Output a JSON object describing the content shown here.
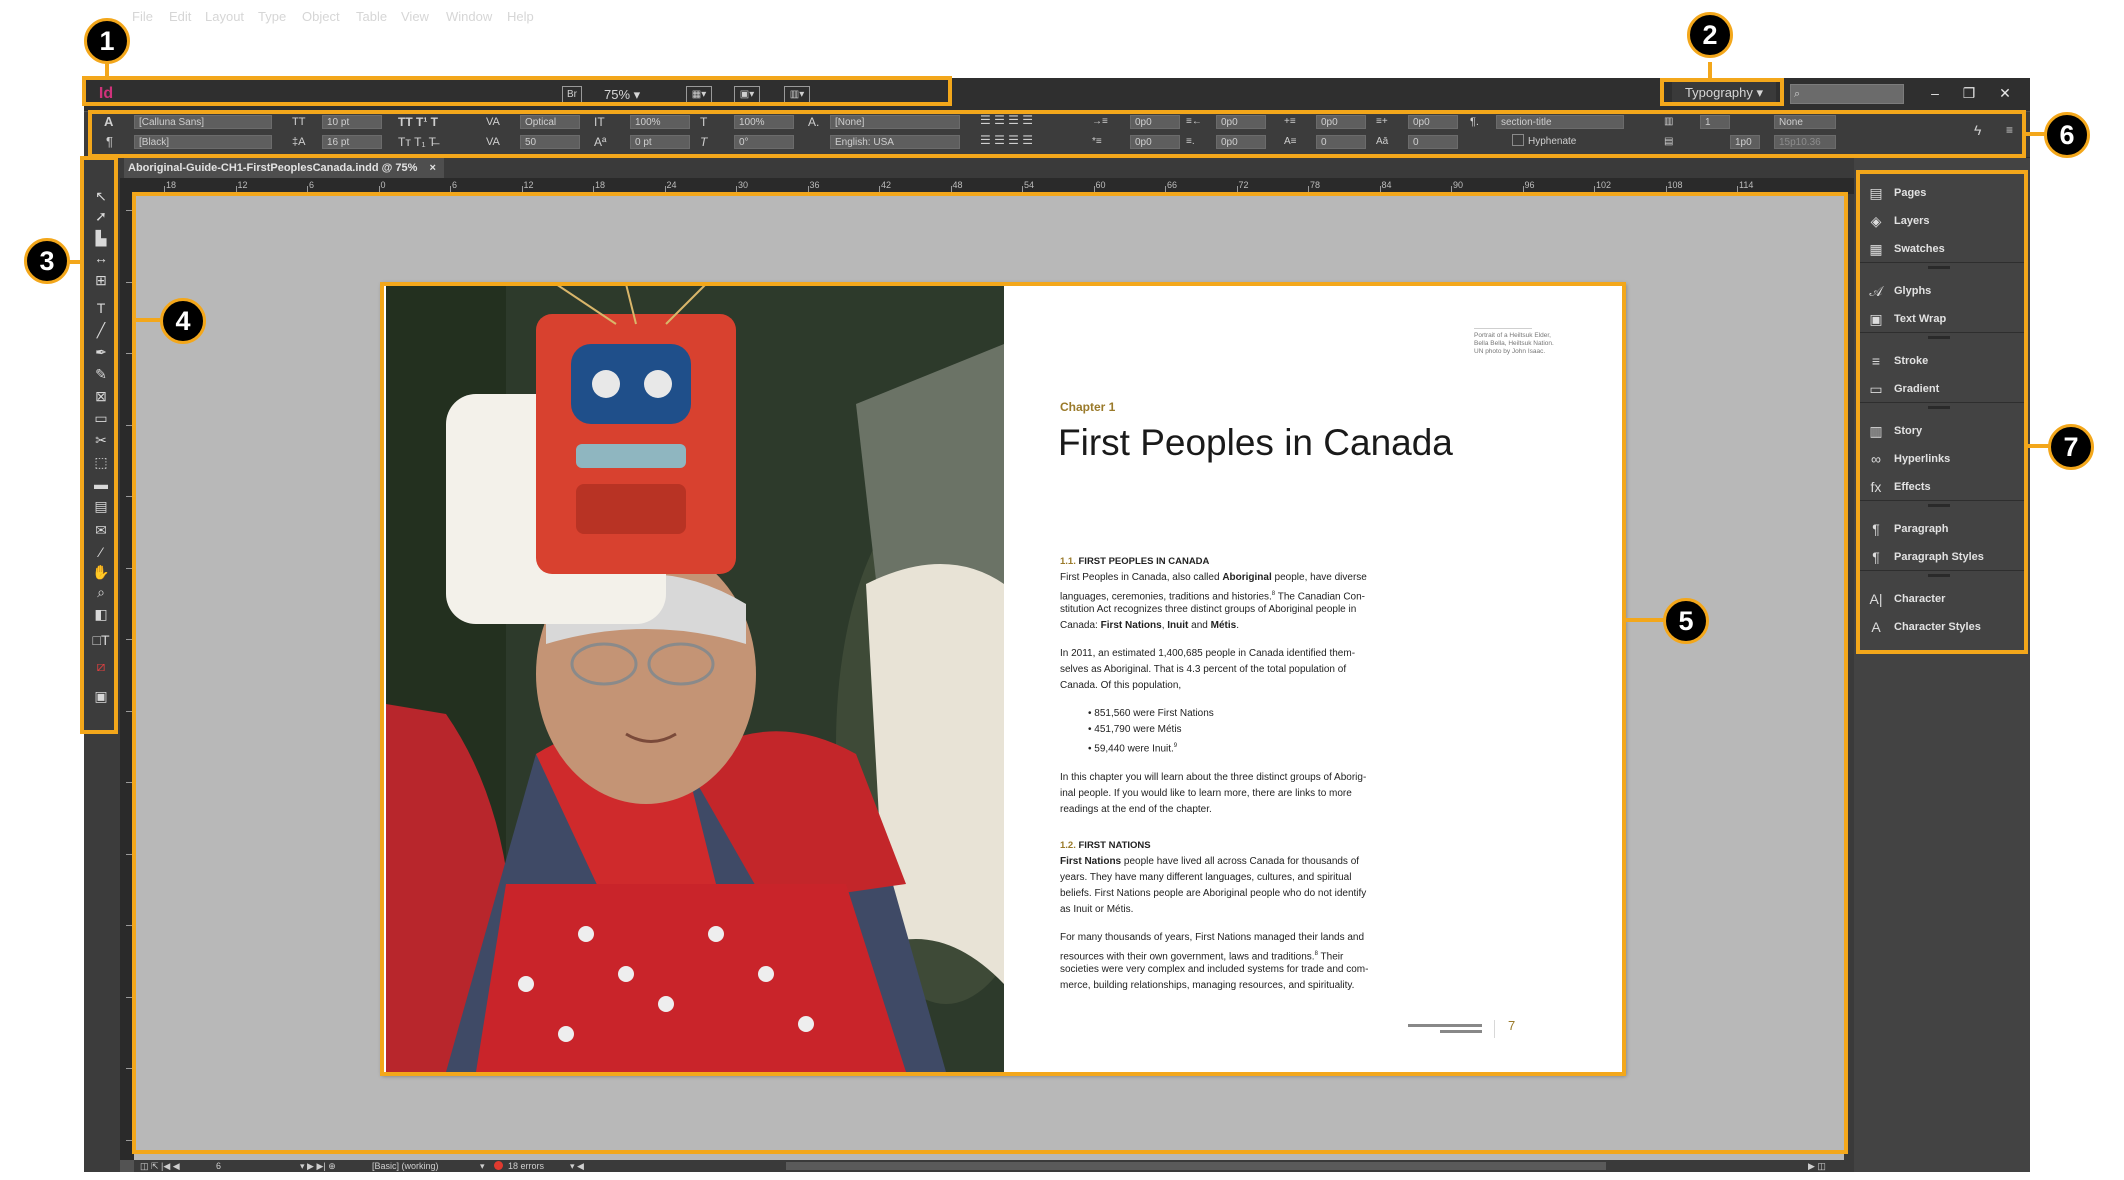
{
  "menubar": {
    "app_logo": "Id",
    "items": [
      "File",
      "Edit",
      "Layout",
      "Type",
      "Object",
      "Table",
      "View",
      "Window",
      "Help"
    ],
    "bridge_label": "Br",
    "zoom": "75%",
    "workspace": "Typography",
    "window_buttons": [
      "–",
      "❐",
      "✕"
    ]
  },
  "control": {
    "font_family": "[Calluna Sans]",
    "font_style": "[Black]",
    "font_size": "10 pt",
    "leading": "16 pt",
    "kerning": "Optical",
    "tracking": "50",
    "vscale": "100%",
    "hscale": "100%",
    "baseline": "0 pt",
    "skew": "0°",
    "char_style": "[None]",
    "language": "English: USA",
    "indent_left": "0p0",
    "indent_right": "0p0",
    "indent_first": "0p0",
    "indent_last": "0p0",
    "space_before": "0p0",
    "space_after": "0p0",
    "dropcap_lines": "0",
    "dropcap_chars": "0",
    "para_style": "section-title",
    "hyphenate": "Hyphenate",
    "columns": "1",
    "gutter": "1p0",
    "align_none": "None",
    "x_value": "15p10.36"
  },
  "document_tab": "Aboriginal-Guide-CH1-FirstPeoplesCanada.indd @ 75%",
  "ruler": [
    "18",
    "12",
    "6",
    "0",
    "6",
    "12",
    "18",
    "24",
    "30",
    "36",
    "42",
    "48",
    "54",
    "60",
    "66",
    "72",
    "78",
    "84",
    "90",
    "96",
    "102",
    "108",
    "114"
  ],
  "status": {
    "page": "6",
    "preflight_profile": "[Basic] (working)",
    "errors": "18 errors"
  },
  "page": {
    "caption": [
      "Portrait of a Heiltsuk Elder,",
      "Bella Bella, Heiltsuk Nation.",
      "UN photo by John Isaac."
    ],
    "chapter": "Chapter 1",
    "title": "First Peoples in Canada",
    "s1_num": "1.1.",
    "s1_title": "FIRST PEOPLES IN CANADA",
    "s1_p1": [
      {
        "a": "First Peoples in Canada, also called ",
        "b": "Aboriginal",
        "c": " people, have diverse"
      },
      {
        "a": "languages, ceremonies, traditions and histories.",
        "sup": "8",
        "c": " The Canadian Con-"
      },
      {
        "a": "stitution Act recognizes three distinct groups of Aboriginal people in"
      },
      {
        "a": "Canada: ",
        "b": "First Nations",
        "c": ", ",
        "b2": "Inuit",
        "d": " and ",
        "b3": "Métis",
        "e": "."
      }
    ],
    "s1_p2": [
      "In 2011, an estimated 1,400,685 people in Canada identified them-",
      "selves as Aboriginal. That is 4.3 percent of the total population of",
      "Canada. Of this population,"
    ],
    "bullets": [
      "851,560 were First Nations",
      "451,790 were Métis",
      "59,440 were Inuit."
    ],
    "bullet_sup": "9",
    "s1_p3": [
      "In this chapter you will learn about the three distinct groups of Aborig-",
      "inal people. If you would like to learn more, there are links to more",
      "readings at the end of the chapter."
    ],
    "s2_num": "1.2.",
    "s2_title": "FIRST NATIONS",
    "s2_p1_bold": "First Nations",
    "s2_p1": [
      " people have lived all across Canada for thousands of",
      "years. They have many different languages, cultures, and spiritual",
      "beliefs. First Nations people are Aboriginal people who do not identify",
      "as Inuit or Métis."
    ],
    "s2_p2": [
      "For many thousands of years, First Nations managed their lands and",
      "resources with their own government, laws and traditions.",
      "societies were very complex and included systems for trade and com-",
      "merce, building relationships, managing resources, and spirituality."
    ],
    "s2_p2_sup": "8",
    "s2_p2_tail": " Their",
    "page_number": "7"
  },
  "panels": [
    {
      "label": "Pages",
      "icon": "pages-icon",
      "glyph": "▤"
    },
    {
      "label": "Layers",
      "icon": "layers-icon",
      "glyph": "◈"
    },
    {
      "label": "Swatches",
      "icon": "swatches-icon",
      "glyph": "▦"
    },
    {
      "label": "Glyphs",
      "icon": "glyphs-icon",
      "glyph": "𝒜"
    },
    {
      "label": "Text Wrap",
      "icon": "text-wrap-icon",
      "glyph": "▣"
    },
    {
      "label": "Stroke",
      "icon": "stroke-icon",
      "glyph": "≡"
    },
    {
      "label": "Gradient",
      "icon": "gradient-icon",
      "glyph": "▭"
    },
    {
      "label": "Story",
      "icon": "story-icon",
      "glyph": "▥"
    },
    {
      "label": "Hyperlinks",
      "icon": "hyperlinks-icon",
      "glyph": "∞"
    },
    {
      "label": "Effects",
      "icon": "effects-icon",
      "glyph": "fx"
    },
    {
      "label": "Paragraph",
      "icon": "paragraph-icon",
      "glyph": "¶"
    },
    {
      "label": "Paragraph Styles",
      "icon": "paragraph-styles-icon",
      "glyph": "¶"
    },
    {
      "label": "Character",
      "icon": "character-icon",
      "glyph": "A|"
    },
    {
      "label": "Character Styles",
      "icon": "character-styles-icon",
      "glyph": "A"
    }
  ],
  "callouts": [
    "1",
    "2",
    "3",
    "4",
    "5",
    "6",
    "7"
  ],
  "colors": {
    "callout_accent": "#f3a71b",
    "interface_dark": "#2f2f2f",
    "pasteboard": "#b8b8b8",
    "chapter_gold": "#9a7a2a",
    "app_logo": "#d0327b"
  }
}
